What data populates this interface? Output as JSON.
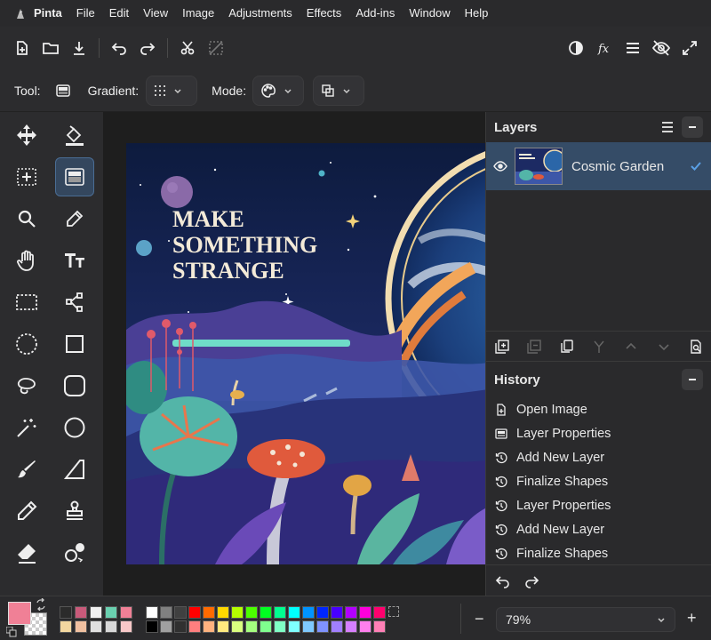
{
  "menubar": {
    "app": "Pinta",
    "items": [
      "File",
      "Edit",
      "View",
      "Image",
      "Adjustments",
      "Effects",
      "Add-ins",
      "Window",
      "Help"
    ]
  },
  "toolbar2": {
    "tool_label": "Tool:",
    "gradient_label": "Gradient:",
    "mode_label": "Mode:"
  },
  "canvas": {
    "headline": [
      "MAKE",
      "SOMETHING",
      "STRANGE"
    ]
  },
  "layers": {
    "title": "Layers",
    "items": [
      {
        "name": "Cosmic Garden",
        "visible": true,
        "selected": true
      }
    ]
  },
  "history": {
    "title": "History",
    "items": [
      "Open Image",
      "Layer Properties",
      "Add New Layer",
      "Finalize Shapes",
      "Layer Properties",
      "Add New Layer",
      "Finalize Shapes"
    ]
  },
  "status": {
    "zoom": "79%",
    "minus": "−",
    "plus": "+"
  },
  "colors": {
    "primary": "#f08096",
    "accent": "#5aa0e6",
    "panel_selected": "#354c67"
  }
}
